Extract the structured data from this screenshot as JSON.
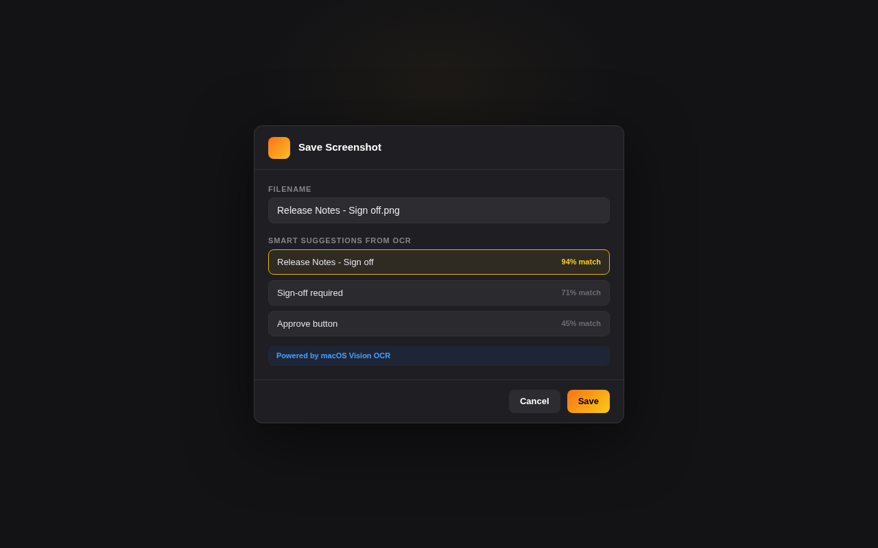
{
  "dialog": {
    "title": "Save Screenshot"
  },
  "filename": {
    "label": "FILENAME",
    "value": "Release Notes - Sign off.png"
  },
  "suggestions": {
    "label": "SMART SUGGESTIONS FROM OCR",
    "items": [
      {
        "text": "Release Notes - Sign off",
        "match": "94% match",
        "selected": true
      },
      {
        "text": "Sign-off required",
        "match": "71% match",
        "selected": false
      },
      {
        "text": "Approve button",
        "match": "45% match",
        "selected": false
      }
    ]
  },
  "footnote": "Powered by macOS Vision OCR",
  "buttons": [
    {
      "label": "Cancel",
      "kind": "secondary"
    },
    {
      "label": "Save",
      "kind": "primary"
    }
  ]
}
